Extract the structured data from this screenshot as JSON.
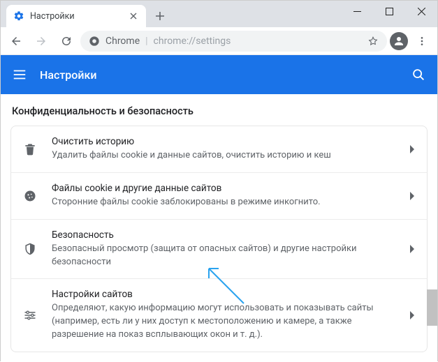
{
  "tab": {
    "title": "Настройки"
  },
  "omnibox": {
    "prefix": "Chrome",
    "rest": "chrome://settings"
  },
  "appbar": {
    "title": "Настройки"
  },
  "section": {
    "title": "Конфиденциальность и безопасность"
  },
  "rows": [
    {
      "title": "Очистить историю",
      "sub": "Удалить файлы cookie и данные сайтов, очистить историю и кеш"
    },
    {
      "title": "Файлы cookie и другие данные сайтов",
      "sub": "Сторонние файлы cookie заблокированы в режиме инкогнито."
    },
    {
      "title": "Безопасность",
      "sub": "Безопасный просмотр (защита от опасных сайтов) и другие настройки безопасности"
    },
    {
      "title": "Настройки сайтов",
      "sub": "Определяют, какую информацию могут использовать и показывать сайты (например, есть ли у них доступ к местоположению и камере, а также разрешение на показ всплывающих окон и т. д.)."
    }
  ]
}
